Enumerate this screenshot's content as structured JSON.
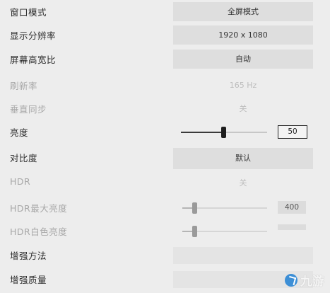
{
  "settings": [
    {
      "label": "窗口模式",
      "value": "全屏模式",
      "state": "enabled"
    },
    {
      "label": "显示分辨率",
      "value": "1920 x 1080",
      "state": "enabled"
    },
    {
      "label": "屏幕高宽比",
      "value": "自动",
      "state": "enabled"
    },
    {
      "label": "刷新率",
      "value": "165 Hz",
      "state": "disabled"
    },
    {
      "label": "垂直同步",
      "value": "关",
      "state": "disabled"
    },
    {
      "label": "亮度",
      "value": "50",
      "state": "enabled",
      "slider_fraction": 0.5
    },
    {
      "label": "对比度",
      "value": "默认",
      "state": "enabled"
    },
    {
      "label": "HDR",
      "value": "关",
      "state": "disabled"
    },
    {
      "label": "HDR最大亮度",
      "value": "400",
      "state": "disabled",
      "slider_fraction": 0.1
    },
    {
      "label": "HDR白色亮度",
      "value": "",
      "state": "disabled",
      "slider_fraction": 0.1
    },
    {
      "label": "增强方法",
      "value": "",
      "state": "enabled"
    },
    {
      "label": "增强质量",
      "value": "",
      "state": "enabled"
    }
  ],
  "watermark": {
    "text": "九游",
    "icon": "jiuyou-logo-icon",
    "color": "#3d8fd6"
  },
  "colors": {
    "background": "#ededed",
    "control": "#dedede",
    "disabled_text": "#a8a8a8"
  }
}
